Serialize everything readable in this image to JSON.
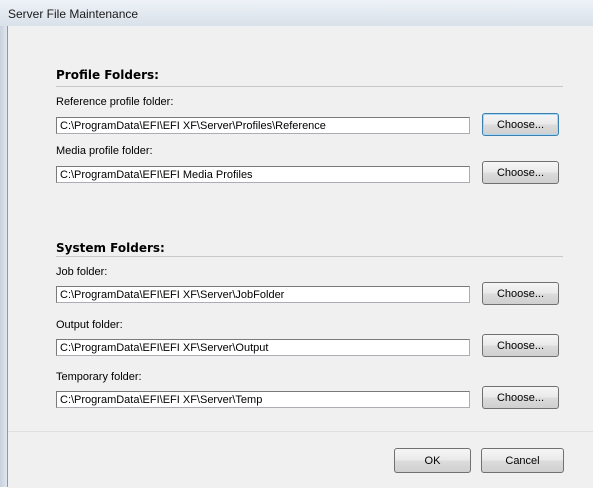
{
  "window": {
    "title": "Server File Maintenance"
  },
  "profile_section": {
    "title": "Profile Folders:",
    "fields": [
      {
        "label": "Reference profile folder:",
        "value": "C:\\ProgramData\\EFI\\EFI XF\\Server\\Profiles\\Reference",
        "button": "Choose..."
      },
      {
        "label": "Media profile folder:",
        "value": "C:\\ProgramData\\EFI\\EFI Media Profiles",
        "button": "Choose..."
      }
    ]
  },
  "system_section": {
    "title": "System Folders:",
    "fields": [
      {
        "label": "Job folder:",
        "value": "C:\\ProgramData\\EFI\\EFI XF\\Server\\JobFolder",
        "button": "Choose..."
      },
      {
        "label": "Output folder:",
        "value": "C:\\ProgramData\\EFI\\EFI XF\\Server\\Output",
        "button": "Choose..."
      },
      {
        "label": "Temporary folder:",
        "value": "C:\\ProgramData\\EFI\\EFI XF\\Server\\Temp",
        "button": "Choose..."
      }
    ]
  },
  "footer": {
    "ok_label": "OK",
    "cancel_label": "Cancel"
  }
}
